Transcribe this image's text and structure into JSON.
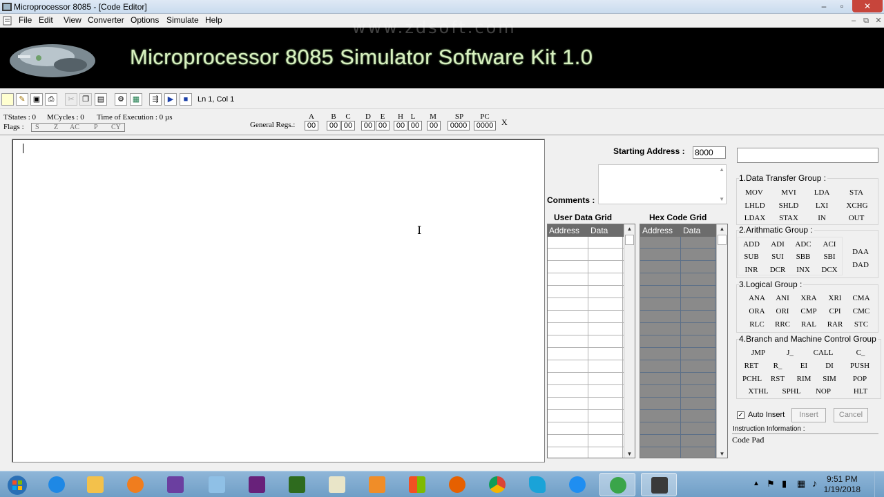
{
  "window": {
    "title": "Microprocessor 8085 - [Code Editor]",
    "controls": {
      "minimize": "–",
      "maximize": "▫",
      "close": "✕"
    }
  },
  "menu": {
    "items": [
      "File",
      "Edit",
      "View",
      "Converter",
      "Options",
      "Simulate",
      "Help"
    ],
    "mdi_controls": {
      "minimize": "–",
      "restore": "⧉",
      "close": "✕"
    }
  },
  "banner": {
    "title": "Microprocessor 8085 Simulator Software Kit 1.0",
    "watermark": "www.zdsoft.com"
  },
  "toolbar": {
    "buttons": [
      "new-icon",
      "open-icon",
      "save-icon",
      "print-icon",
      "cut-icon",
      "copy-icon",
      "paste-icon",
      "assemble-icon",
      "compile-icon",
      "step-icon",
      "run-icon",
      "stop-icon"
    ],
    "cursor_position": "Ln 1, Col 1"
  },
  "status": {
    "tstates": "TStates : 0",
    "mcycles": "MCycles : 0",
    "time": "Time of Execution : 0 µs",
    "flags_label": "Flags :",
    "flags": [
      "S",
      "Z",
      "AC",
      "P",
      "CY"
    ],
    "general_regs_label": "General Regs.:",
    "registers": [
      {
        "name": "A",
        "value": "00"
      },
      {
        "name": "B",
        "value": "00"
      },
      {
        "name": "C",
        "value": "00"
      },
      {
        "name": "D",
        "value": "00"
      },
      {
        "name": "E",
        "value": "00"
      },
      {
        "name": "H",
        "value": "00"
      },
      {
        "name": "L",
        "value": "00"
      },
      {
        "name": "M",
        "value": "00"
      },
      {
        "name": "SP",
        "value": "0000"
      },
      {
        "name": "PC",
        "value": "0000"
      }
    ],
    "close_label": "X"
  },
  "right_panel": {
    "starting_address_label": "Starting Address :",
    "starting_address_value": "8000",
    "comments_label": "Comments :",
    "user_grid": {
      "title": "User Data Grid",
      "col_address": "Address",
      "col_data": "Data"
    },
    "hex_grid": {
      "title": "Hex Code Grid",
      "col_address": "Address",
      "col_data": "Data"
    }
  },
  "instructions": {
    "data_transfer": {
      "title": "1.Data Transfer Group :",
      "buttons": [
        "MOV",
        "MVI",
        "LDA",
        "STA",
        "LHLD",
        "SHLD",
        "LXI",
        "XCHG",
        "LDAX",
        "STAX",
        "IN",
        "OUT"
      ]
    },
    "arithmetic": {
      "title": "2.Arithmatic  Group :",
      "buttons": [
        "ADD",
        "ADI",
        "ADC",
        "ACI",
        "SUB",
        "SUI",
        "SBB",
        "SBI",
        "INR",
        "DCR",
        "INX",
        "DCX"
      ],
      "side_buttons": [
        "DAA",
        "DAD"
      ]
    },
    "logical": {
      "title": "3.Logical  Group :",
      "buttons": [
        "ANA",
        "ANI",
        "XRA",
        "XRI",
        "CMA",
        "ORA",
        "ORI",
        "CMP",
        "CPI",
        "CMC",
        "RLC",
        "RRC",
        "RAL",
        "RAR",
        "STC"
      ]
    },
    "branch": {
      "title": "4.Branch and Machine Control Group",
      "buttons": [
        "JMP",
        "J_",
        "CALL",
        "C_",
        "RET",
        "R_",
        "EI",
        "DI",
        "PUSH",
        "PCHL",
        "RST",
        "RIM",
        "SIM",
        "POP",
        "XTHL",
        "SPHL",
        "NOP",
        "HLT"
      ]
    },
    "auto_insert_label": "Auto Insert",
    "auto_insert_checked": true,
    "insert_label": "Insert",
    "cancel_label": "Cancel",
    "info_label": "Instruction Information :",
    "code_pad_label": "Code Pad"
  },
  "taskbar": {
    "apps": [
      "start-orb",
      "internet-explorer",
      "file-explorer",
      "media-player",
      "visual-studio-purple",
      "3d-box-app",
      "visual-studio",
      "dreamweaver",
      "chart-app",
      "sublime-text",
      "windows-app",
      "firefox",
      "chrome",
      "arrow-app",
      "messenger",
      "globe-app",
      "8085-simulator"
    ],
    "active_app": "8085-simulator",
    "time": "9:51 PM",
    "date": "1/19/2018"
  },
  "colors": {
    "banner_bg": "#000000",
    "banner_text": "#d8f0c0",
    "hex_grid_bg": "#8a8a8a",
    "taskbar": "#7aa7cf"
  }
}
